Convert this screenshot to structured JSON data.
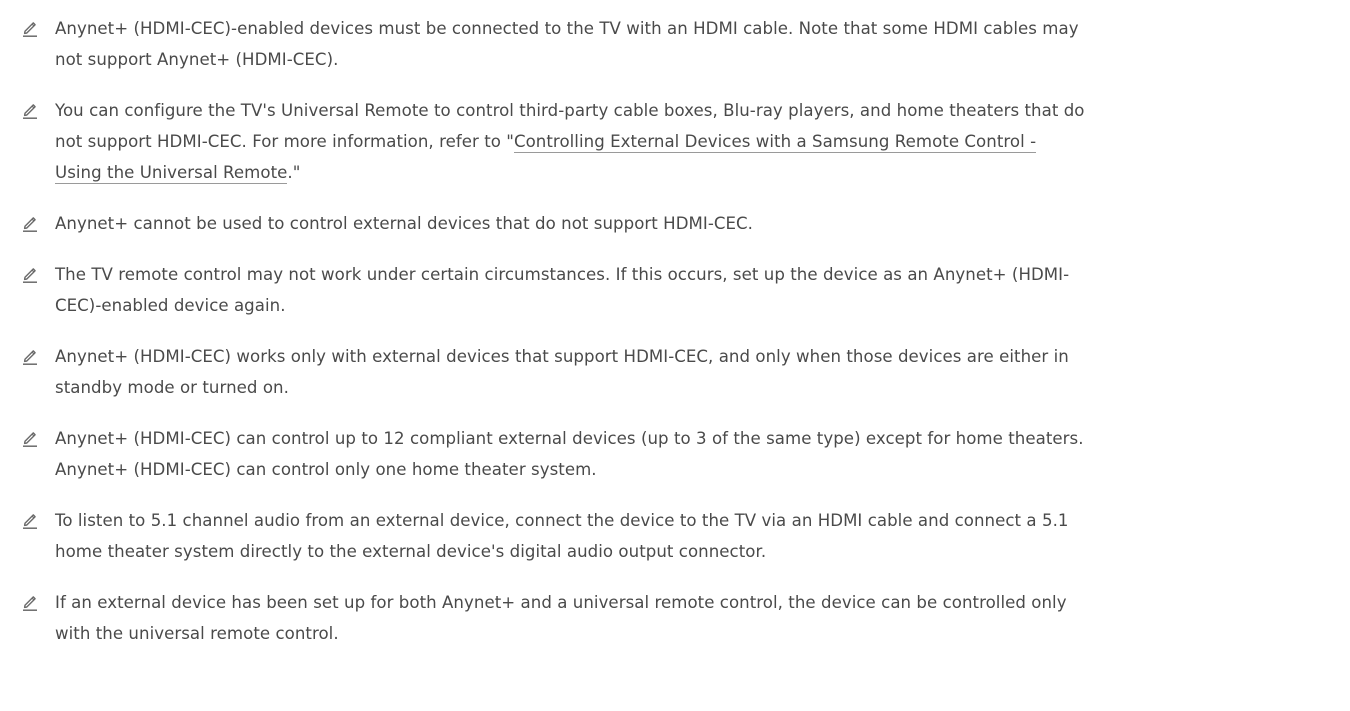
{
  "colors": {
    "text": "#4a4a4a",
    "icon": "#6b6b6b",
    "link_underline": "#9a9a9a",
    "background": "#ffffff"
  },
  "note_icon": "pencil-note-icon",
  "notes": [
    {
      "text": "Anynet+ (HDMI-CEC)-enabled devices must be connected to the TV with an HDMI cable. Note that some HDMI cables may\nnot support Anynet+ (HDMI-CEC)."
    },
    {
      "text_before": "You can configure the TV's Universal Remote to control third-party cable boxes, Blu-ray players, and home theaters that do\nnot support HDMI-CEC. For more information, refer to \"",
      "link_line1": "Controlling External Devices with a Samsung Remote Control -",
      "link_line2": "Using the Universal Remote",
      "text_after": ".\""
    },
    {
      "text": "Anynet+ cannot be used to control external devices that do not support HDMI-CEC."
    },
    {
      "text": "The TV remote control may not work under certain circumstances. If this occurs, set up the device as an Anynet+ (HDMI-\nCEC)-enabled device again."
    },
    {
      "text": "Anynet+ (HDMI-CEC) works only with external devices that support HDMI-CEC, and only when those devices are either in\nstandby mode or turned on."
    },
    {
      "text": "Anynet+ (HDMI-CEC) can control up to 12 compliant external devices (up to 3 of the same type) except for home theaters.\nAnynet+ (HDMI-CEC) can control only one home theater system."
    },
    {
      "text": "To listen to 5.1 channel audio from an external device, connect the device to the TV via an HDMI cable and connect a 5.1\nhome theater system directly to the external device's digital audio output connector."
    },
    {
      "text": "If an external device has been set up for both Anynet+ and a universal remote control, the device can be controlled only\nwith the universal remote control."
    }
  ]
}
